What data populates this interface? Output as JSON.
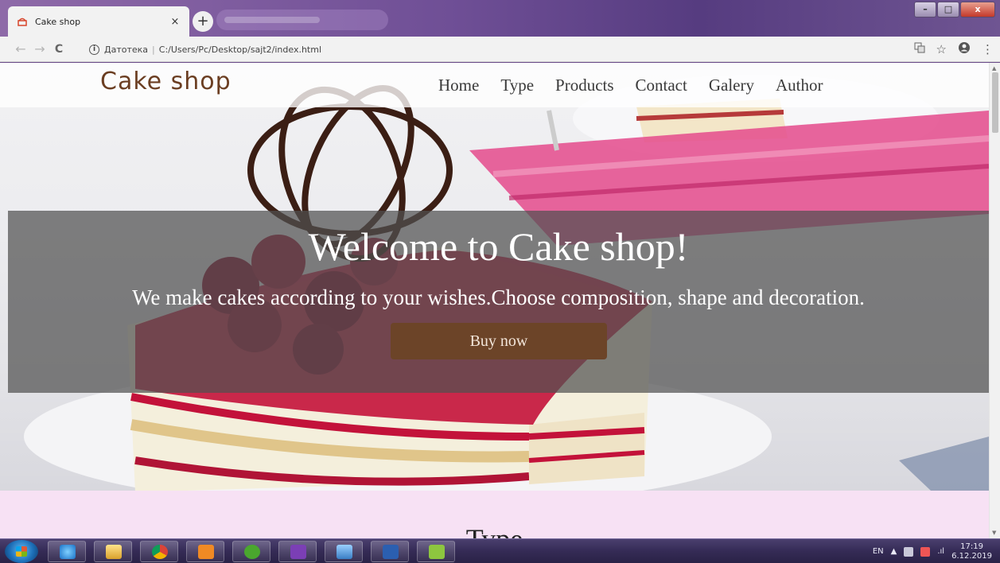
{
  "browser": {
    "tab_title": "Cake shop",
    "tab_close": "×",
    "new_tab": "+",
    "win_minimize": "–",
    "win_maximize": "□",
    "win_close": "x",
    "back": "←",
    "forward": "→",
    "reload": "C",
    "info": "i",
    "address_prefix": "Датотека",
    "address_url": "C:/Users/Pc/Desktop/sajt2/index.html"
  },
  "site": {
    "logo": "Cake shop",
    "menu": [
      "Home",
      "Type",
      "Products",
      "Contact",
      "Galery",
      "Author"
    ]
  },
  "hero": {
    "title": "Welcome to Cake shop!",
    "subtitle": "We make cakes according to your wishes.Choose composition, shape and decoration.",
    "button": "Buy now"
  },
  "type_section": {
    "title": "Type"
  },
  "taskbar": {
    "language": "EN",
    "time": "17:19",
    "date": "6.12.2019",
    "apps": [
      "internet-explorer",
      "file-explorer",
      "chrome",
      "media-player",
      "utorrent",
      "visual-studio",
      "control-panel",
      "word",
      "notepad-plus-plus"
    ]
  },
  "colors": {
    "logo": "#6b3e22",
    "button": "#6c4428",
    "banner_overlay": "#505050",
    "type_section_bg": "#f7e1f4"
  }
}
